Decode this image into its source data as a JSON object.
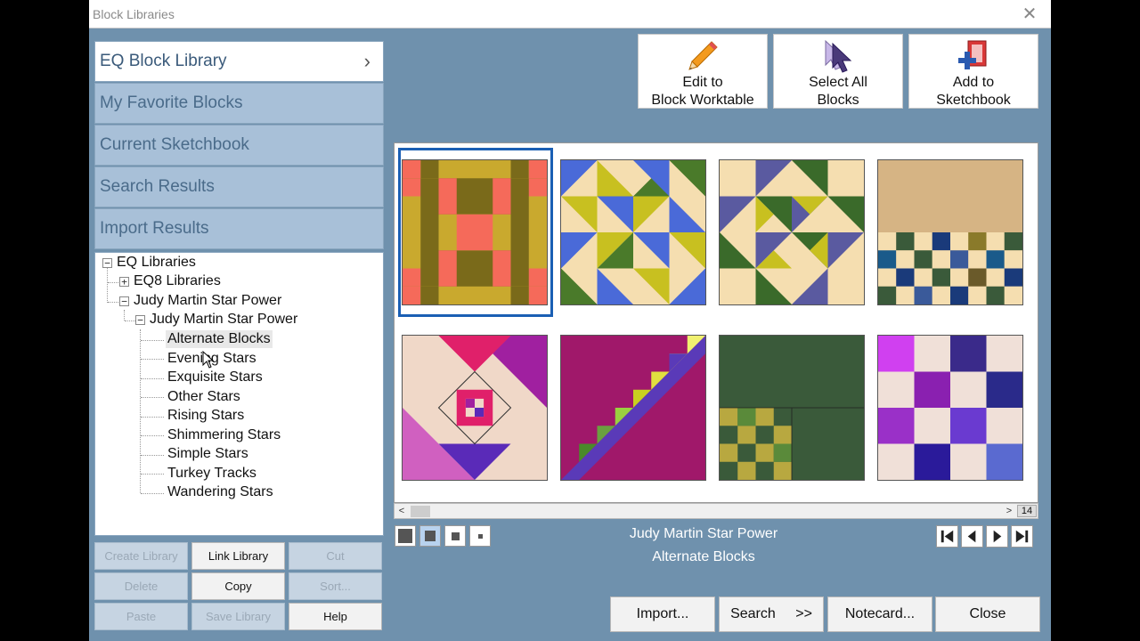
{
  "window": {
    "title": "Block Libraries",
    "close_glyph": "✕"
  },
  "nav": {
    "items": [
      {
        "label": "EQ Block Library",
        "active": true
      },
      {
        "label": "My Favorite Blocks"
      },
      {
        "label": "Current Sketchbook"
      },
      {
        "label": "Search Results"
      },
      {
        "label": "Import Results"
      }
    ],
    "chevron": "›"
  },
  "tree": {
    "root": "EQ Libraries",
    "eq8": "EQ8 Libraries",
    "jm_top": "Judy Martin Star Power",
    "jm_sub": "Judy Martin Star Power",
    "children": [
      "Alternate Blocks",
      "Evening Stars",
      "Exquisite Stars",
      "Other Stars",
      "Rising Stars",
      "Shimmering Stars",
      "Simple Stars",
      "Turkey Tracks",
      "Wandering Stars"
    ],
    "selected_index": 0
  },
  "buttons": {
    "create_library": "Create Library",
    "link_library": "Link Library",
    "cut": "Cut",
    "delete": "Delete",
    "copy": "Copy",
    "sort": "Sort...",
    "paste": "Paste",
    "save_library": "Save Library",
    "help": "Help"
  },
  "toolbar": {
    "edit_line1": "Edit to",
    "edit_line2": "Block Worktable",
    "select_line1": "Select All",
    "select_line2": "Blocks",
    "add_line1": "Add to",
    "add_line2": "Sketchbook"
  },
  "scroll": {
    "left": "<",
    "right": ">",
    "page_count": "14"
  },
  "caption": {
    "library": "Judy Martin Star Power",
    "category": "Alternate Blocks"
  },
  "bottom": {
    "import": "Import...",
    "search": "Search",
    "search_arrows": ">>",
    "notecard": "Notecard...",
    "close": "Close"
  },
  "colors": {
    "background": "#6f91ad",
    "nav_inactive": "#a8c0d8",
    "selection": "#1a5fb4"
  }
}
